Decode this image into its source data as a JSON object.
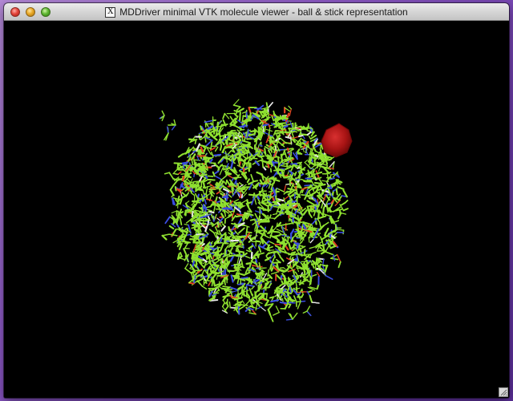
{
  "window": {
    "title": "MDDriver minimal VTK molecule viewer - ball & stick representation",
    "app_icon_glyph": "X",
    "app_icon": "x11-icon"
  },
  "controls": {
    "close": "close-icon",
    "minimize": "minimize-icon",
    "zoom": "zoom-icon"
  },
  "scene": {
    "background_color": "#000000",
    "representation": "ball & stick",
    "atom_colors": {
      "carbon": "#8fe030",
      "nitrogen": "#3a4de0",
      "oxygen": "#e04020",
      "hydrogen": "#e8e8e8"
    },
    "highlight_sphere_color": "#b01818"
  },
  "resize_grip": "resize-grip-icon"
}
